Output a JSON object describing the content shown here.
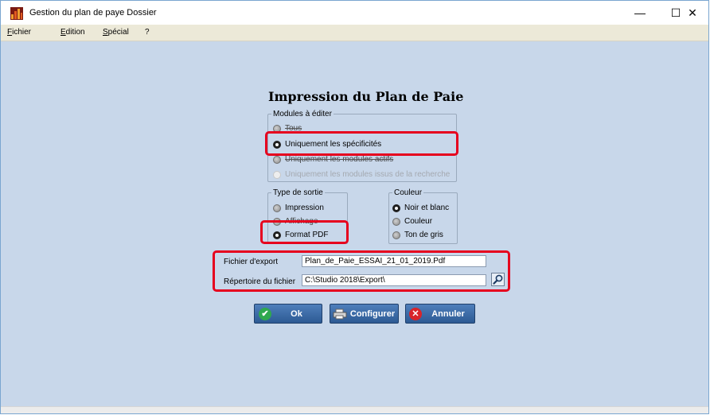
{
  "window": {
    "title": "Gestion du plan de paye Dossier",
    "controls": {
      "minimize": "—",
      "maximize": "☐",
      "close": "✕"
    }
  },
  "menu": {
    "items": [
      {
        "key": "F",
        "rest": "ichier"
      },
      {
        "key": "E",
        "rest": "dition"
      },
      {
        "key": "S",
        "rest": "pécial"
      },
      {
        "key": "?",
        "rest": ""
      }
    ]
  },
  "dialog": {
    "title": "Impression du Plan de Paie",
    "modules": {
      "legend": "Modules à éditer",
      "options": [
        {
          "label": "Tous",
          "state": "off"
        },
        {
          "label": "Uniquement les spécificités",
          "state": "on"
        },
        {
          "label": "Uniquement les modules actifs",
          "state": "off"
        },
        {
          "label": "Uniquement les modules issus de la recherche",
          "state": "disabled"
        }
      ]
    },
    "output_type": {
      "legend": "Type de sortie",
      "options": [
        {
          "label": "Impression",
          "state": "off"
        },
        {
          "label": "Affichage",
          "state": "off"
        },
        {
          "label": "Format PDF",
          "state": "on"
        }
      ]
    },
    "color": {
      "legend": "Couleur",
      "options": [
        {
          "label": "Noir et blanc",
          "state": "on"
        },
        {
          "label": "Couleur",
          "state": "off"
        },
        {
          "label": "Ton de gris",
          "state": "off"
        }
      ]
    },
    "export_file": {
      "label": "Fichier d'export",
      "value": "Plan_de_Paie_ESSAI_21_01_2019.Pdf"
    },
    "export_dir": {
      "label": "Répertoire du fichier",
      "value": "C:\\Studio 2018\\Export\\"
    },
    "buttons": {
      "ok": "Ok",
      "configure": "Configurer",
      "cancel": "Annuler"
    }
  },
  "colors": {
    "client_background": "#c8d7ea",
    "highlight": "#e6001e",
    "button_blue": "#3d6ca8",
    "ok_icon": "#2fa84f",
    "cancel_icon": "#d8242a"
  }
}
